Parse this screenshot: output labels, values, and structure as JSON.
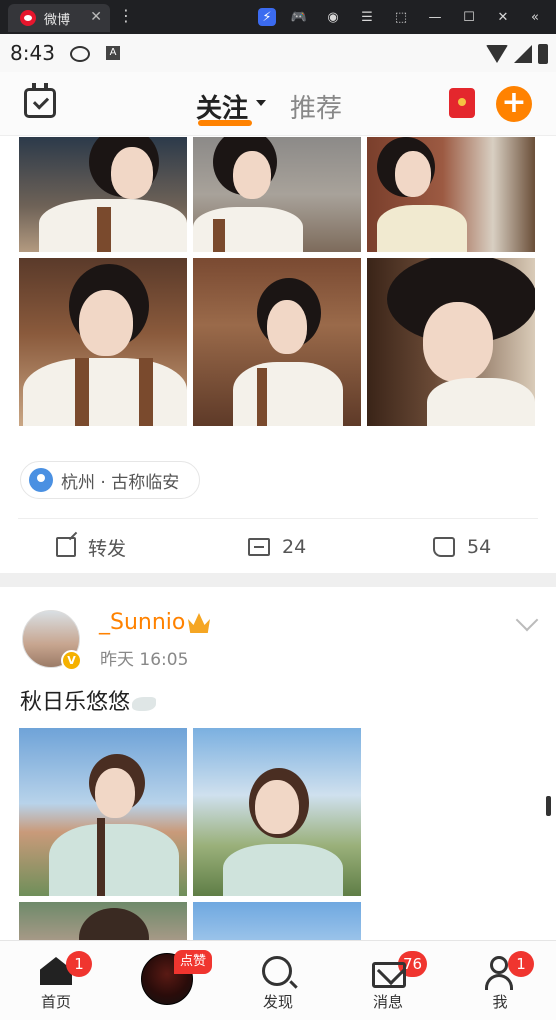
{
  "window": {
    "tab_title": "微博",
    "close_glyph": "✕",
    "menu_glyph": "⋮"
  },
  "statusbar": {
    "time": "8:43",
    "icons": [
      "weibo-icon",
      "a-icon",
      "wifi-icon",
      "cell-signal-icon",
      "battery-icon"
    ]
  },
  "header": {
    "tab_follow": "关注",
    "tab_recommend": "推荐"
  },
  "post1": {
    "location": "杭州 · 古称临安",
    "actions": {
      "repost_label": "转发",
      "comment_count": "24",
      "like_count": "54"
    }
  },
  "post2": {
    "username": "_Sunnio",
    "time": "昨天 16:05",
    "text": "秋日乐悠悠"
  },
  "bottomnav": {
    "home_label": "首页",
    "home_badge": "1",
    "center_tag": "点赞",
    "discover_label": "发现",
    "messages_label": "消息",
    "messages_badge": "76",
    "me_label": "我",
    "me_badge": "1"
  },
  "colors": {
    "accent": "#ff8200",
    "badge": "#f0352f",
    "location_pin": "#4a90e2"
  }
}
